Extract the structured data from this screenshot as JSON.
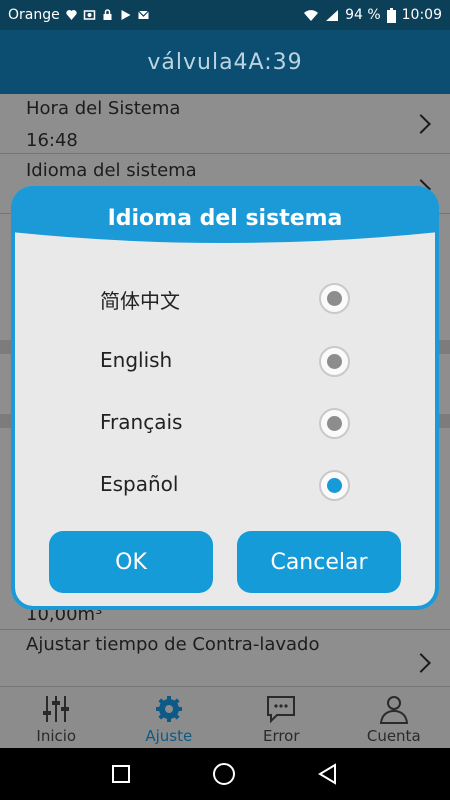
{
  "status_bar": {
    "carrier": "Orange",
    "battery": "94 %",
    "time": "10:09"
  },
  "header": {
    "title": "válvula4A:39"
  },
  "list": {
    "rows": [
      {
        "label": "Hora del Sistema",
        "value": "16:48"
      },
      {
        "label": "Idioma del sistema",
        "value": ""
      },
      {
        "label": "",
        "value": "10,00m³"
      },
      {
        "label": "Ajustar tiempo de Contra-lavado",
        "value": ""
      }
    ]
  },
  "dialog": {
    "title": "Idioma del sistema",
    "options": [
      {
        "label": "简体中文",
        "selected": false
      },
      {
        "label": "English",
        "selected": false
      },
      {
        "label": "Français",
        "selected": false
      },
      {
        "label": "Español",
        "selected": true
      }
    ],
    "ok_label": "OK",
    "cancel_label": "Cancelar"
  },
  "bottom_nav": {
    "items": [
      {
        "label": "Inicio",
        "icon": "sliders-icon",
        "active": false
      },
      {
        "label": "Ajuste",
        "icon": "gear-icon",
        "active": true
      },
      {
        "label": "Error",
        "icon": "chat-bubble-icon",
        "active": false
      },
      {
        "label": "Cuenta",
        "icon": "person-icon",
        "active": false
      }
    ]
  },
  "colors": {
    "accent": "#169bd9",
    "header": "#0b4e72"
  }
}
